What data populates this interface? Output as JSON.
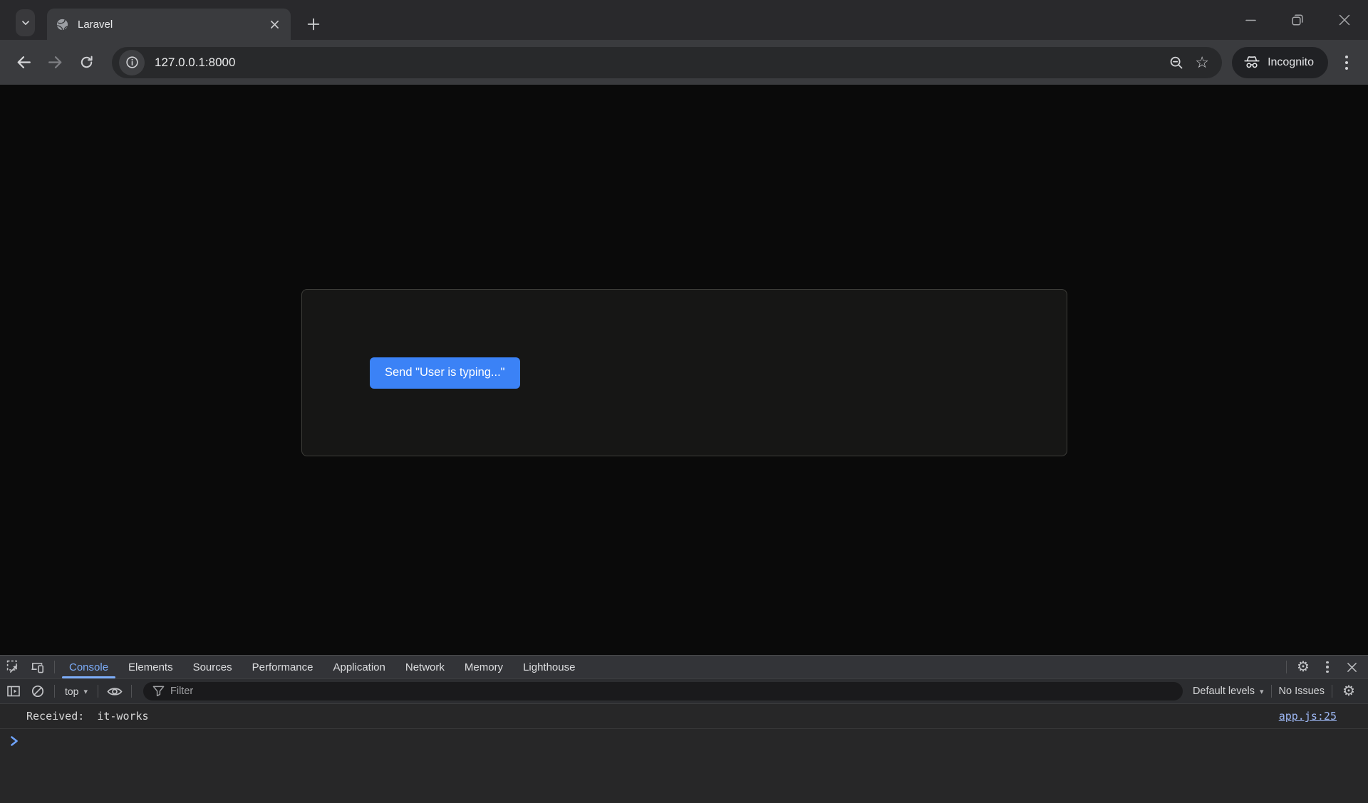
{
  "browser": {
    "tab_title": "Laravel",
    "url": "127.0.0.1:8000",
    "incognito_label": "Incognito"
  },
  "page": {
    "send_button_label": "Send \"User is typing...\""
  },
  "devtools": {
    "tabs": [
      {
        "label": "Console"
      },
      {
        "label": "Elements"
      },
      {
        "label": "Sources"
      },
      {
        "label": "Performance"
      },
      {
        "label": "Application"
      },
      {
        "label": "Network"
      },
      {
        "label": "Memory"
      },
      {
        "label": "Lighthouse"
      }
    ],
    "toolbar": {
      "context_selector": "top",
      "filter_placeholder": "Filter",
      "levels_selector": "Default levels",
      "issues_status": "No Issues"
    },
    "console": {
      "message": "Received:  it-works",
      "source_link": "app.js:25"
    }
  },
  "colors": {
    "devtools_accent_blue": "#7cacf8",
    "button_blue": "#3b82f6",
    "console_link_blue": "#9db7f3",
    "page_background": "#0a0a0a",
    "card_background": "#161615",
    "card_border": "#3e3e3a"
  }
}
